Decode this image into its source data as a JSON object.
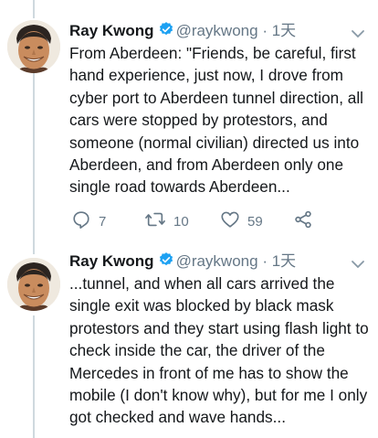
{
  "tweets": [
    {
      "author": {
        "name": "Ray Kwong",
        "handle": "@raykwong",
        "verified": true
      },
      "separator": "·",
      "time": "1天",
      "text": "From Aberdeen: \"Friends, be careful, first hand experience, just now, I drove from cyber port to Aberdeen tunnel direction, all cars were stopped by protestors, and someone (normal civilian) directed us into Aberdeen, and from Aberdeen only one single road towards Aberdeen...",
      "actions": {
        "replies": "7",
        "retweets": "10",
        "likes": "59"
      }
    },
    {
      "author": {
        "name": "Ray Kwong",
        "handle": "@raykwong",
        "verified": true
      },
      "separator": "·",
      "time": "1天",
      "text": "...tunnel, and when all cars arrived the single exit was blocked by black mask protestors and they start using flash light to check inside the car, the driver of the Mercedes in front of me has to show the mobile (I don't know why), but for me I only got checked and wave hands..."
    }
  ],
  "colors": {
    "accent": "#1da1f2",
    "muted": "#657786",
    "text": "#14171a",
    "thread_line": "#cfd9de"
  },
  "icons": [
    "reply-icon",
    "retweet-icon",
    "like-icon",
    "share-icon",
    "verified-icon",
    "chevron-down-icon",
    "avatar"
  ]
}
